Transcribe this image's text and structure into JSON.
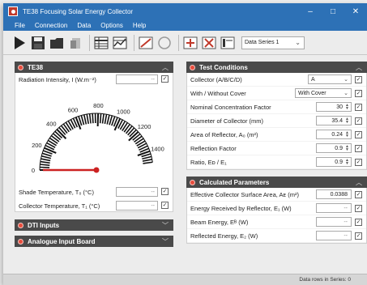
{
  "window": {
    "title": "TE38 Focusing Solar Energy Collector",
    "controls": {
      "minimize": "–",
      "maximize": "□",
      "close": "✕"
    }
  },
  "menu": [
    "File",
    "Connection",
    "Data",
    "Options",
    "Help"
  ],
  "toolbar": {
    "series_value": "Data Series 1",
    "icons": [
      "play-icon",
      "save-icon",
      "open-folder-icon",
      "new-document-icon",
      "table-icon",
      "graph-icon",
      "chart-settings-icon",
      "circle-icon",
      "add-series-icon",
      "delete-series-icon",
      "series-settings-icon"
    ]
  },
  "te38_panel": {
    "title": "TE38",
    "radiation_label": "Radiation Intensity, I  (W.m⁻²)",
    "radiation_value": "--",
    "gauge": {
      "tick_labels": [
        "0",
        "200",
        "400",
        "600",
        "800",
        "1000",
        "1200",
        "1400"
      ],
      "min": 0,
      "max": 1500,
      "value": 0
    },
    "shade_temp_label": "Shade Temperature, T₀  (°C)",
    "shade_temp_value": "--",
    "collector_temp_label": "Collector Temperature, T₁  (°C)",
    "collector_temp_value": "--"
  },
  "dti_panel": {
    "title": "DTI Inputs"
  },
  "analogue_panel": {
    "title": "Analogue Input Board"
  },
  "test_conditions": {
    "title": "Test Conditions",
    "rows": [
      {
        "label": "Collector (A/B/C/D)",
        "value": "A",
        "kind": "select"
      },
      {
        "label": "With / Without Cover",
        "value": "With Cover",
        "kind": "select"
      },
      {
        "label": "Nominal Concentration Factor",
        "value": "30",
        "kind": "number"
      },
      {
        "label": "Diameter of Collector  (mm)",
        "value": "35.4",
        "kind": "number"
      },
      {
        "label": "Area of Reflector, A₀  (m²)",
        "value": "0.24",
        "kind": "number"
      },
      {
        "label": "Reflection Factor",
        "value": "0.9",
        "kind": "number"
      },
      {
        "label": "Ratio, Eᴅ / E₁",
        "value": "0.9",
        "kind": "number"
      }
    ]
  },
  "calculated": {
    "title": "Calculated Parameters",
    "rows": [
      {
        "label": "Effective Collector Surface Area, Aᴇ  (m²)",
        "value": "0.0388"
      },
      {
        "label": "Energy Received by Reflector, E₁  (W)",
        "value": "--"
      },
      {
        "label": "Beam Energy, Eᴮ  (W)",
        "value": "--"
      },
      {
        "label": "Reflected Energy, E₂  (W)",
        "value": "--"
      }
    ]
  },
  "status": {
    "text": "Data rows in Series: 0"
  },
  "colors": {
    "titlebar": "#2d71b6",
    "panel_header": "#4a4a4a",
    "needle": "#cc2222",
    "header_dot": "#e74c3c"
  }
}
